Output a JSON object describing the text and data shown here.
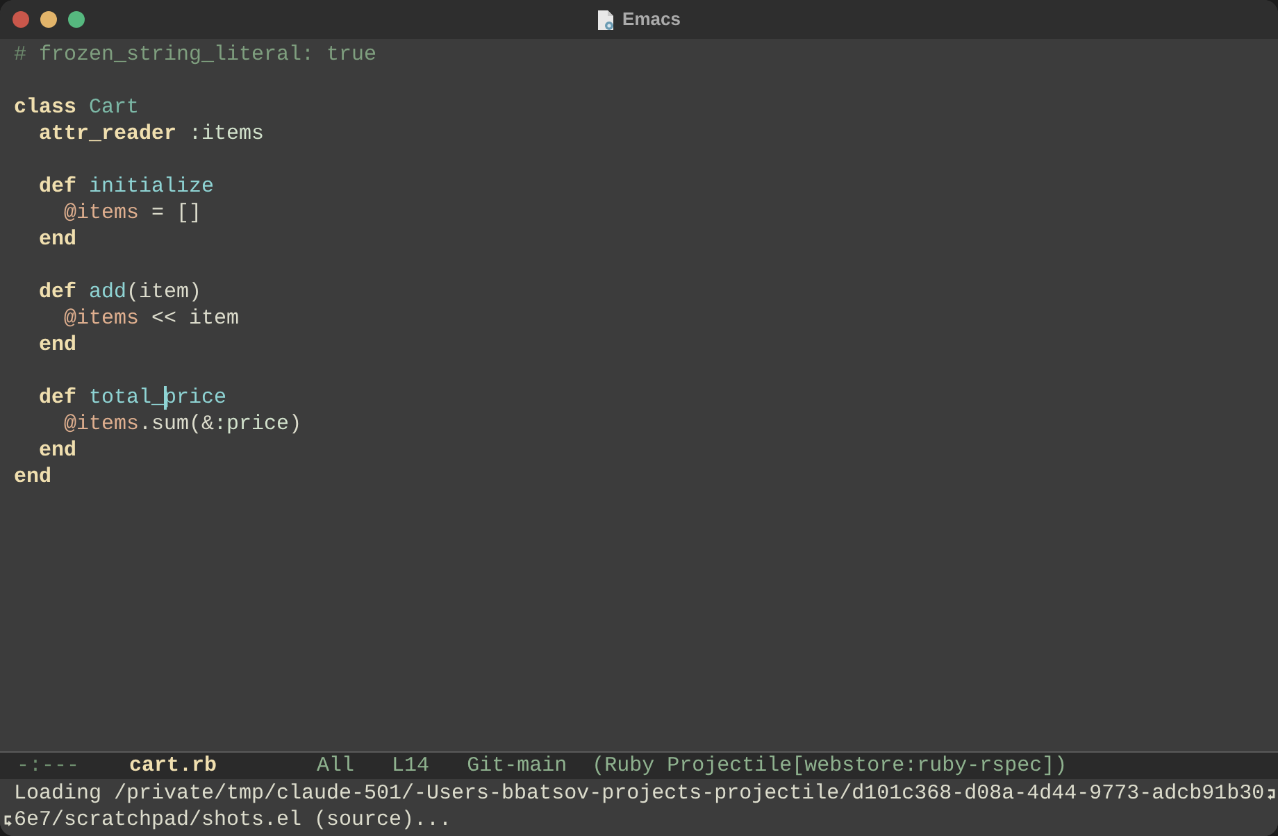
{
  "window": {
    "title": "Emacs"
  },
  "buffer": {
    "lines": [
      {
        "kind": "code",
        "tokens": [
          {
            "text": "#",
            "kind": "comment_delimiter"
          },
          {
            "text": " frozen_string_literal: true",
            "kind": "comment"
          }
        ]
      },
      {
        "kind": "blank"
      },
      {
        "kind": "code",
        "tokens": [
          {
            "text": "class",
            "kind": "keyword"
          },
          {
            "text": " Cart",
            "kind": "type"
          }
        ]
      },
      {
        "kind": "code",
        "tokens": [
          {
            "text": "  attr_reader",
            "kind": "keyword"
          },
          {
            "text": " :items",
            "kind": "symbol"
          }
        ]
      },
      {
        "kind": "blank"
      },
      {
        "kind": "code",
        "tokens": [
          {
            "text": "  def",
            "kind": "keyword"
          },
          {
            "text": " initialize",
            "kind": "function"
          }
        ]
      },
      {
        "kind": "code",
        "tokens": [
          {
            "text": "    @items",
            "kind": "variable"
          },
          {
            "text": " = []",
            "kind": "plain"
          }
        ]
      },
      {
        "kind": "code",
        "tokens": [
          {
            "text": "  end",
            "kind": "keyword"
          }
        ]
      },
      {
        "kind": "blank"
      },
      {
        "kind": "code",
        "tokens": [
          {
            "text": "  def",
            "kind": "keyword"
          },
          {
            "text": " add",
            "kind": "function"
          },
          {
            "text": "(item)",
            "kind": "plain"
          }
        ]
      },
      {
        "kind": "code",
        "tokens": [
          {
            "text": "    @items",
            "kind": "variable"
          },
          {
            "text": " << item",
            "kind": "plain"
          }
        ]
      },
      {
        "kind": "code",
        "tokens": [
          {
            "text": "  end",
            "kind": "keyword"
          }
        ]
      },
      {
        "kind": "blank"
      },
      {
        "kind": "code",
        "tokens": [
          {
            "text": "  def",
            "kind": "keyword"
          },
          {
            "text": " total_",
            "kind": "function"
          },
          {
            "text": "price",
            "kind": "function",
            "cursor": true
          }
        ]
      },
      {
        "kind": "code",
        "tokens": [
          {
            "text": "    @items",
            "kind": "variable"
          },
          {
            "text": ".sum(&",
            "kind": "plain"
          },
          {
            "text": ":price",
            "kind": "symbol"
          },
          {
            "text": ")",
            "kind": "plain"
          }
        ]
      },
      {
        "kind": "code",
        "tokens": [
          {
            "text": "  end",
            "kind": "keyword"
          }
        ]
      },
      {
        "kind": "code",
        "tokens": [
          {
            "text": "end",
            "kind": "keyword"
          }
        ]
      }
    ]
  },
  "mode_line": {
    "status": "-:---",
    "buffer_name": "cart.rb",
    "position": "All",
    "line": "L14",
    "vc": "Git-main",
    "modes": "(Ruby Projectile[webstore:ruby-rspec])"
  },
  "echo_area": {
    "lines": [
      "Loading /private/tmp/claude-501/-Users-bbatsov-projects-projectile/d101c368-d08a-4d44-9773-adcb91b30",
      "6e7/scratchpad/shots.el (source)..."
    ]
  }
}
